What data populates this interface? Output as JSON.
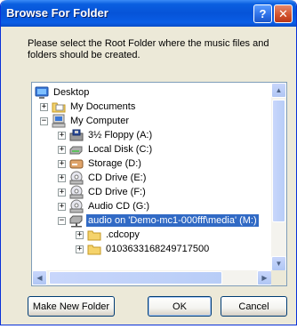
{
  "window": {
    "title": "Browse For Folder",
    "help_label": "?",
    "close_label": "✕"
  },
  "instruction": "Please select the Root Folder where the music files and folders should be created.",
  "tree": {
    "items": [
      {
        "label": "Desktop",
        "icon": "desktop-icon",
        "expander": ""
      },
      {
        "label": "My Documents",
        "icon": "folder-icon",
        "expander": "+"
      },
      {
        "label": "My Computer",
        "icon": "computer-icon",
        "expander": "−"
      },
      {
        "label": "3½ Floppy (A:)",
        "icon": "floppy-icon",
        "expander": "+"
      },
      {
        "label": "Local Disk (C:)",
        "icon": "hard-disk-icon",
        "expander": "+"
      },
      {
        "label": "Storage (D:)",
        "icon": "storage-drive-icon",
        "expander": "+"
      },
      {
        "label": "CD Drive (E:)",
        "icon": "cd-drive-icon",
        "expander": "+"
      },
      {
        "label": "CD Drive (F:)",
        "icon": "cd-drive-icon",
        "expander": "+"
      },
      {
        "label": "Audio CD (G:)",
        "icon": "cd-drive-icon",
        "expander": "+"
      },
      {
        "label": "audio on 'Demo-mc1-000fff\\media' (M:)",
        "icon": "network-drive-icon",
        "expander": "−",
        "selected": true
      },
      {
        "label": ".cdcopy",
        "icon": "folder-icon",
        "expander": "+"
      },
      {
        "label": "0103633168249717500",
        "icon": "folder-icon",
        "expander": "+"
      }
    ]
  },
  "buttons": {
    "make_new_folder": "Make New Folder",
    "ok": "OK",
    "cancel": "Cancel"
  },
  "colors": {
    "titlebar": "#0a5ee6",
    "selection": "#316ac5",
    "dialog_bg": "#ece9d8"
  }
}
